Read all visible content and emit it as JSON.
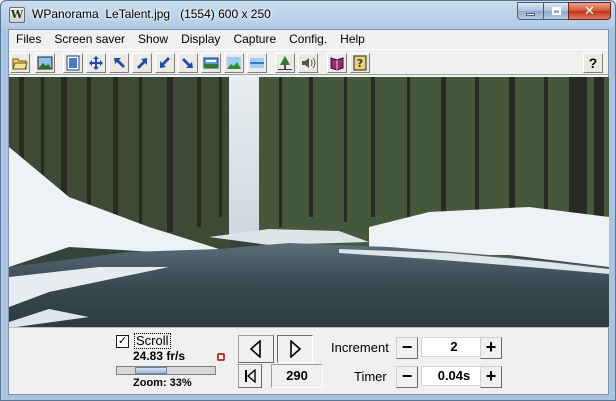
{
  "window": {
    "title": "WPanorama  LeTalent.jpg   (1554) 600 x 250",
    "icon_letter": "W"
  },
  "caption_buttons": [
    "minimize-icon",
    "maximize-icon",
    "close-icon"
  ],
  "menu": {
    "items": [
      "Files",
      "Screen saver",
      "Show",
      "Display",
      "Capture",
      "Config.",
      "Help"
    ]
  },
  "toolbar": {
    "buttons": [
      "open-folder-icon",
      "picture-icon",
      "fit-window-icon",
      "move-arrows-icon",
      "arrow-up-left-icon",
      "arrow-up-right-icon",
      "arrow-down-left-icon",
      "arrow-down-right-icon",
      "panorama-icon",
      "landscape-icon",
      "horizon-icon",
      "tree-icon",
      "speaker-icon",
      "book-icon",
      "help-book-icon"
    ],
    "help_label": "?"
  },
  "panorama": {
    "description_icon": "landscape-image"
  },
  "controls": {
    "scroll_label": "Scroll",
    "scroll_checked": true,
    "check_mark": "✓",
    "fps": "24.83 fr/s",
    "zoom": "Zoom: 33%",
    "zoom_fraction": 0.33,
    "position": "290",
    "increment_label": "Increment",
    "increment_value": "2",
    "timer_label": "Timer",
    "timer_value": "0.04s",
    "minus": "−",
    "plus": "+"
  }
}
